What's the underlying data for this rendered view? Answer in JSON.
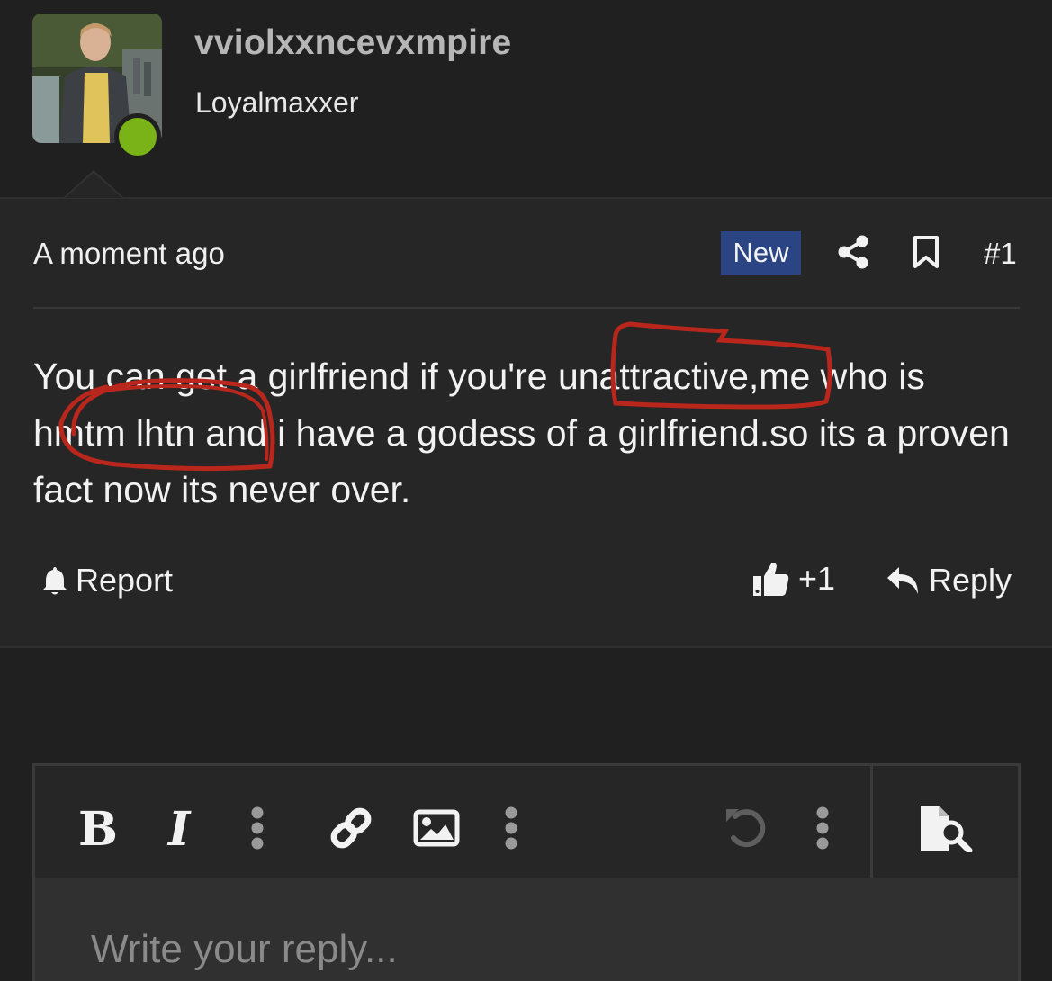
{
  "user": {
    "username": "vviolxxncevxmpire",
    "title": "Loyalmaxxer",
    "online": true
  },
  "post": {
    "time": "A moment ago",
    "badge": "New",
    "number": "#1",
    "body": "You can get a girlfriend if you're unattractive,me who is hmtm lhtn and i have a godess of a girlfriend.so its a proven fact now its never over.",
    "report_label": "Report",
    "like_count": "+1",
    "reply_label": "Reply"
  },
  "editor": {
    "bold_label": "B",
    "italic_label": "I",
    "placeholder": "Write your reply..."
  },
  "icons": {
    "share": "share-icon",
    "bookmark": "bookmark-icon",
    "report": "bell-icon",
    "like": "thumbs-up-icon",
    "reply": "reply-arrow-icon",
    "link": "link-icon",
    "image": "image-icon",
    "undo": "undo-icon",
    "more": "vertical-dots-icon",
    "preview": "file-search-icon"
  },
  "colors": {
    "background": "#202020",
    "post_background": "#262626",
    "badge_new": "#2a4484",
    "online": "#7ab317",
    "annotation": "#b8261c"
  }
}
